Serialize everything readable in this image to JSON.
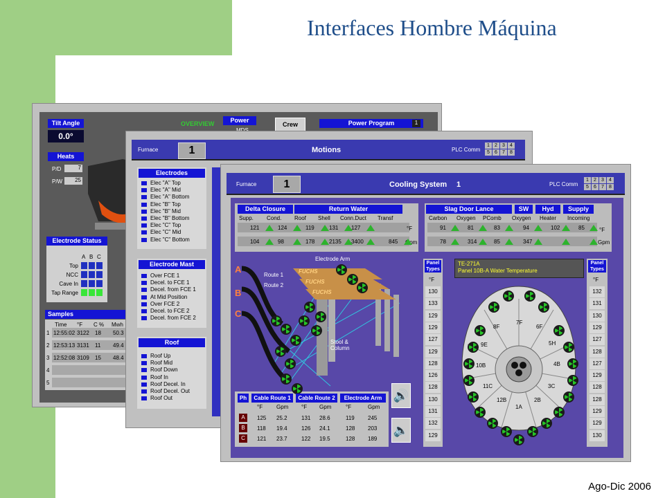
{
  "slide": {
    "title": "Interfaces Hombre Máquina",
    "footer": "Ago-Dic 2006"
  },
  "overview": {
    "title": "OVERVIEW",
    "tilt_angle_label": "Tilt Angle",
    "tilt_angle_value": "0.0°",
    "heats_label": "Heats",
    "pd_label": "P/D",
    "pd_value": "7",
    "pw_label": "P/W",
    "pw_value": "25",
    "power_label": "Power",
    "mds_label": "MDS",
    "crew_label": "Crew",
    "power_program_label": "Power Program",
    "power_program_value": "1",
    "electrode_status_label": "Electrode Status",
    "status_cols": [
      "A",
      "B",
      "C"
    ],
    "status_rows": [
      "Top",
      "NCC",
      "Cave In",
      "Tap Range"
    ],
    "samples_label": "Samples",
    "samples_headers": [
      "Time",
      "°F",
      "C %",
      "Mwh"
    ],
    "samples_rows": [
      {
        "n": "1",
        "time": "12:55:02",
        "f": "3122",
        "c": "18",
        "mwh": "50.3"
      },
      {
        "n": "2",
        "time": "12:53:13",
        "f": "3131",
        "c": "11",
        "mwh": "49.4"
      },
      {
        "n": "3",
        "time": "12:52:08",
        "f": "3109",
        "c": "15",
        "mwh": "48.4"
      },
      {
        "n": "4",
        "time": "",
        "f": "",
        "c": "",
        "mwh": ""
      },
      {
        "n": "5",
        "time": "",
        "f": "",
        "c": "",
        "mwh": ""
      }
    ]
  },
  "motions": {
    "furnace_label": "Furnace",
    "furnace_value": "1",
    "title": "Motions",
    "plc_label": "PLC Comm",
    "plc_cells": [
      "1",
      "2",
      "3",
      "4",
      "5",
      "6",
      "7",
      "8"
    ],
    "electrodes_label": "Electrodes",
    "electrodes_items": [
      "Elec \"A\" Top",
      "Elec \"A\" Mid",
      "Elec \"A\" Bottom",
      "Elec \"B\" Top",
      "Elec \"B\" Mid",
      "Elec \"B\" Bottom",
      "Elec \"C\" Top",
      "Elec \"C\" Mid",
      "Elec \"C\" Bottom"
    ],
    "mast_label": "Electrode Mast",
    "mast_items": [
      "Over FCE 1",
      "Decel. to FCE 1",
      "Decel. from FCE 1",
      "At Mid Position",
      "Over FCE 2",
      "Decel. to FCE 2",
      "Decel. from FCE 2"
    ],
    "roof_label": "Roof",
    "roof_items": [
      "Roof Up",
      "Roof Mid",
      "Roof Down",
      "Roof In",
      "Roof Decel. In",
      "Roof Decel. Out",
      "Roof Out"
    ]
  },
  "cooling": {
    "furnace_label": "Furnace",
    "furnace_value": "1",
    "title": "Cooling System",
    "title_num": "1",
    "plc_label": "PLC Comm",
    "plc_cells": [
      "1",
      "2",
      "3",
      "4",
      "5",
      "6",
      "7",
      "8"
    ],
    "delta_closure_label": "Delta Closure",
    "return_water_label": "Return Water",
    "water_cols": [
      "Supp.",
      "Cond.",
      "Roof",
      "Shell",
      "Conn.Duct",
      "Transf"
    ],
    "water_f": [
      "121",
      "124",
      "119",
      "131",
      "127",
      ""
    ],
    "water_gpm": [
      "104",
      "98",
      "178",
      "2135",
      "3400",
      "845"
    ],
    "f_unit": "°F",
    "gpm_unit": "Gpm",
    "slag_label": "Slag Door Lance",
    "sw_label": "SW",
    "hyd_label": "Hyd",
    "supply_label": "Supply",
    "slag_cols": [
      "Carbon",
      "Oxygen",
      "PComb",
      "Oxygen",
      "Heater",
      "Incoming"
    ],
    "slag_f": [
      "91",
      "81",
      "83",
      "94",
      "102",
      "85"
    ],
    "slag_gpm": [
      "78",
      "314",
      "85",
      "347",
      "",
      ""
    ],
    "electrode_arm_label": "Electrode Arm",
    "brand": "FUCHS",
    "phase_letters": [
      "A",
      "B",
      "C"
    ],
    "route1_label": "Route 1",
    "route2_label": "Route 2",
    "stool_label": "Stool &",
    "column_label": "Column",
    "cable_table": {
      "headers": [
        "Ph",
        "Cable Route 1",
        "Cable Route 2",
        "Electrode Arm"
      ],
      "sub_headers": [
        "°F",
        "Gpm",
        "°F",
        "Gpm",
        "°F",
        "Gpm"
      ],
      "rows": [
        {
          "ph": "A",
          "v": [
            "125",
            "25.2",
            "131",
            "28.6",
            "119",
            "245"
          ]
        },
        {
          "ph": "B",
          "v": [
            "118",
            "19.4",
            "126",
            "24.1",
            "128",
            "203"
          ]
        },
        {
          "ph": "C",
          "v": [
            "121",
            "23.7",
            "122",
            "19.5",
            "128",
            "189"
          ]
        }
      ]
    },
    "panel_types_label_1": "Panel",
    "panel_types_label_2": "Types",
    "panel_unit": "°F",
    "left_panel_values": [
      "130",
      "133",
      "129",
      "129",
      "127",
      "129",
      "128",
      "126",
      "128",
      "130",
      "131",
      "132",
      "129"
    ],
    "right_panel_values": [
      "132",
      "131",
      "130",
      "129",
      "127",
      "128",
      "127",
      "129",
      "128",
      "128",
      "129",
      "129",
      "130"
    ],
    "tag_id": "TE-271A",
    "tag_desc": "Panel 10B-A Water Temperature",
    "roof_panels": [
      "7F",
      "8F",
      "6F",
      "9E",
      "5H",
      "10B",
      "4B",
      "11C",
      "3C",
      "12B",
      "2B",
      "1A"
    ]
  }
}
